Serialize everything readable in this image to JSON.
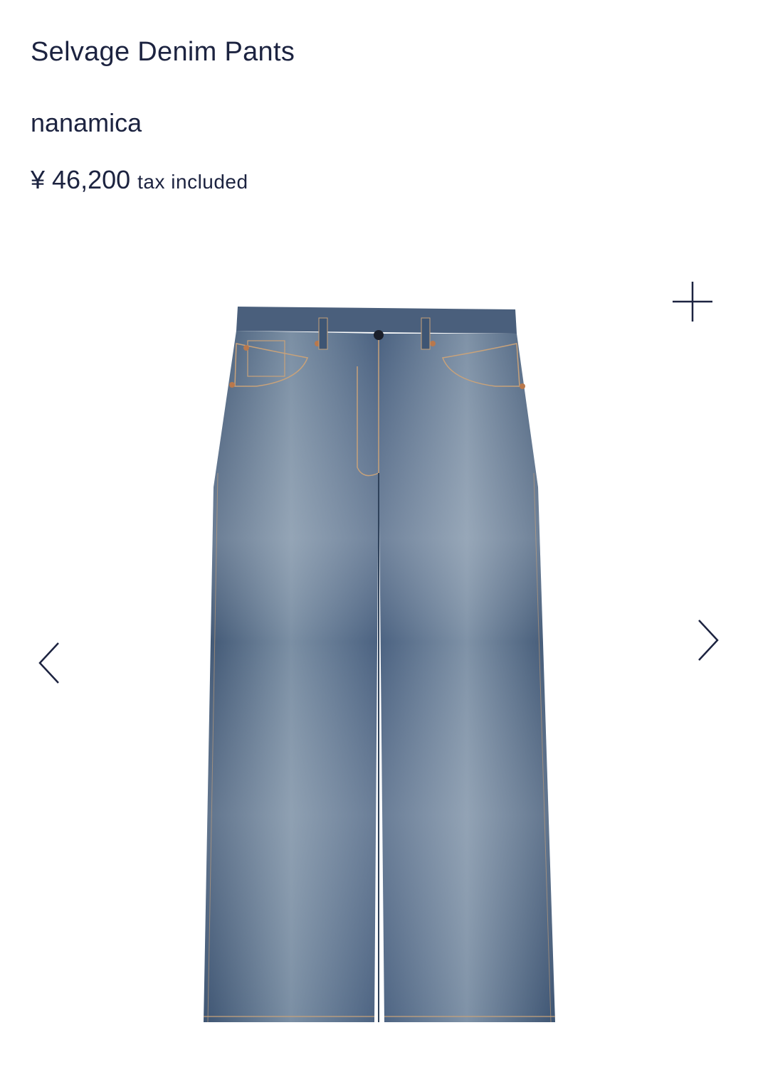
{
  "product": {
    "title": "Selvage Denim Pants",
    "brand": "nanamica",
    "price": "¥ 46,200",
    "price_note": "tax included"
  },
  "gallery": {
    "image_subject": "indigo selvage denim jeans",
    "icons": {
      "zoom": "plus-icon",
      "previous": "chevron-left-icon",
      "next": "chevron-right-icon"
    }
  },
  "colors": {
    "text": "#1c2340",
    "background": "#ffffff",
    "denim_dark": "#3e5573",
    "denim_light": "#8a9db0"
  }
}
